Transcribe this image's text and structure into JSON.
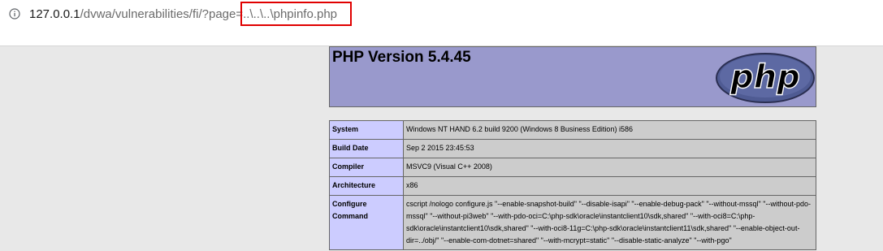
{
  "browser": {
    "url_host": "127.0.0.1",
    "url_path": "/dvwa/vulnerabilities/fi/?page=..\\..\\..\\phpinfo.php",
    "info_icon": "info-circle-icon",
    "highlight_color": "#e00000"
  },
  "phpinfo": {
    "title": "PHP Version 5.4.45",
    "logo_text": "php",
    "logo_icon": "php-logo-icon",
    "header_color": "#9999cc",
    "label_color": "#ccccff",
    "value_color": "#cccccc",
    "rows": [
      {
        "label": "System",
        "value": "Windows NT HAND 6.2 build 9200 (Windows 8 Business Edition) i586"
      },
      {
        "label": "Build Date",
        "value": "Sep 2 2015 23:45:53"
      },
      {
        "label": "Compiler",
        "value": "MSVC9 (Visual C++ 2008)"
      },
      {
        "label": "Architecture",
        "value": "x86"
      },
      {
        "label": "Configure Command",
        "value": "cscript /nologo configure.js \"--enable-snapshot-build\" \"--disable-isapi\" \"--enable-debug-pack\" \"--without-mssql\" \"--without-pdo-mssql\" \"--without-pi3web\" \"--with-pdo-oci=C:\\php-sdk\\oracle\\instantclient10\\sdk,shared\" \"--with-oci8=C:\\php-sdk\\oracle\\instantclient10\\sdk,shared\" \"--with-oci8-11g=C:\\php-sdk\\oracle\\instantclient11\\sdk,shared\" \"--enable-object-out-dir=../obj/\" \"--enable-com-dotnet=shared\" \"--with-mcrypt=static\" \"--disable-static-analyze\" \"--with-pgo\""
      }
    ]
  }
}
